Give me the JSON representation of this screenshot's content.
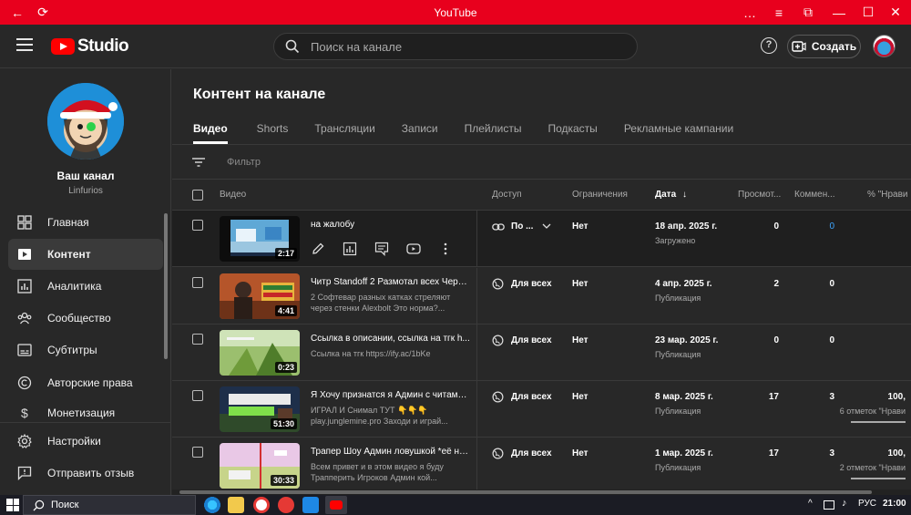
{
  "window": {
    "title": "YouTube",
    "buttons": [
      "←",
      "⟳",
      "…",
      "≡",
      "⧉",
      "—",
      "☐",
      "✕"
    ]
  },
  "header": {
    "logo_text": "Studio",
    "search_placeholder": "Поиск на канале",
    "help_glyph": "?",
    "create_label": "Создать"
  },
  "sidebar": {
    "channel_name": "Ваш канал",
    "channel_handle": "Linfurios",
    "items": [
      {
        "label": "Главная",
        "icon": "dashboard-icon"
      },
      {
        "label": "Контент",
        "icon": "content-icon",
        "active": true
      },
      {
        "label": "Аналитика",
        "icon": "analytics-icon"
      },
      {
        "label": "Сообщество",
        "icon": "community-icon"
      },
      {
        "label": "Субтитры",
        "icon": "subtitles-icon"
      },
      {
        "label": "Авторские права",
        "icon": "copyright-icon"
      },
      {
        "label": "Монетизация",
        "icon": "monetization-icon"
      }
    ],
    "bottom_items": [
      {
        "label": "Настройки",
        "icon": "gear-icon"
      },
      {
        "label": "Отправить отзыв",
        "icon": "feedback-icon"
      }
    ]
  },
  "main": {
    "title": "Контент на канале",
    "tabs": [
      "Видео",
      "Shorts",
      "Трансляции",
      "Записи",
      "Плейлисты",
      "Подкасты",
      "Рекламные кампании"
    ],
    "filter_label": "Фильтр",
    "columns": {
      "video": "Видео",
      "access": "Доступ",
      "restrictions": "Ограничения",
      "date": "Дата",
      "views": "Просмот...",
      "comments": "Коммен...",
      "likes": "% \"Нрави"
    },
    "rows": [
      {
        "title": "на жалобу",
        "description": "",
        "duration": "2:17",
        "visibility": "По ...",
        "restrictions": "Нет",
        "date": "18 апр. 2025 г.",
        "date_status": "Загружено",
        "views": "0",
        "comments": "0",
        "likes": "",
        "likes_sub": "",
        "likes_fill": 0
      },
      {
        "title": "Читр Standoff 2 Размотал всех Чере...",
        "description": "2 Софтевар разных катках стреляют через стенки Alexbolt Это норма?...",
        "duration": "4:41",
        "visibility": "Для всех",
        "restrictions": "Нет",
        "date": "4 апр. 2025 г.",
        "date_status": "Публикация",
        "views": "2",
        "comments": "0",
        "likes": "",
        "likes_sub": "",
        "likes_fill": 0
      },
      {
        "title": "Ссылка в описании, ссылка на тгк h...",
        "description": "Ссылка на тгк https://ify.ac/1bKe",
        "duration": "0:23",
        "visibility": "Для всех",
        "restrictions": "Нет",
        "date": "23 мар. 2025 г.",
        "date_status": "Публикация",
        "views": "0",
        "comments": "0",
        "likes": "",
        "likes_sub": "",
        "likes_fill": 0
      },
      {
        "title": "Я Хочу признатся я Админ с читами...",
        "description": "ИГРАЛ И Снимал ТУТ 👇👇👇 play.junglemine.pro Заходи и играй...",
        "duration": "51:30",
        "visibility": "Для всех",
        "restrictions": "Нет",
        "date": "8 мар. 2025 г.",
        "date_status": "Публикация",
        "views": "17",
        "comments": "3",
        "likes": "100,",
        "likes_sub": "6 отметок \"Нрави",
        "likes_fill": 1
      },
      {
        "title": "Трапер Шоу Админ ловушкой *её ни...",
        "description": "Всем привет и в этом видео я буду Трапперить Игроков Админ кой...",
        "duration": "30:33",
        "visibility": "Для всех",
        "restrictions": "Нет",
        "date": "1 мар. 2025 г.",
        "date_status": "Публикация",
        "views": "17",
        "comments": "3",
        "likes": "100,",
        "likes_sub": "2 отметок \"Нрави",
        "likes_fill": 1
      }
    ]
  },
  "taskbar": {
    "search_label": "Поиск",
    "lang": "РУС",
    "time": "21:00"
  }
}
